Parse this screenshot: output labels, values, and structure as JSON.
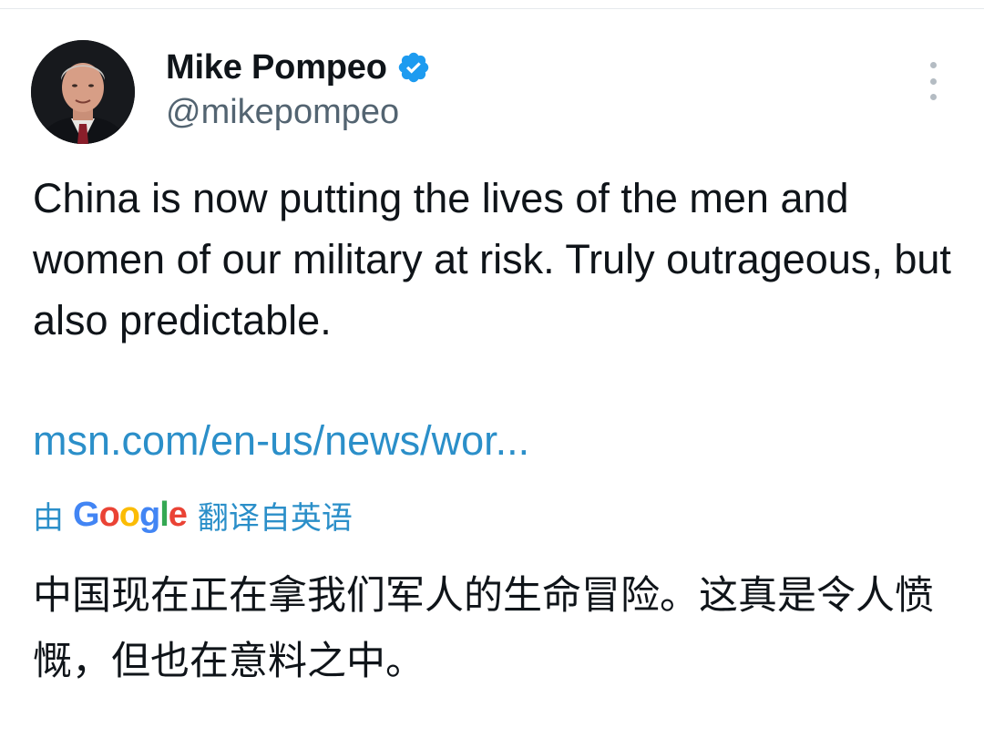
{
  "tweet": {
    "author": {
      "display_name": "Mike Pompeo",
      "handle": "@mikepompeo",
      "verified": true,
      "avatar_icon": "profile-photo"
    },
    "text": "China is now putting the lives of the men and women of our military at risk. Truly outrageous, but also predictable.",
    "link": "msn.com/en-us/news/wor...",
    "translation": {
      "prefix": "由",
      "provider": "Google",
      "suffix": "翻译自英语",
      "text": "中国现在正在拿我们军人的生命冒险。这真是令人愤慨，但也在意料之中。"
    },
    "more_icon": "more-vertical-icon"
  },
  "colors": {
    "text_primary": "#0f1419",
    "text_secondary": "#536471",
    "link": "#2b8fc9",
    "verified": "#1d9bf0"
  }
}
